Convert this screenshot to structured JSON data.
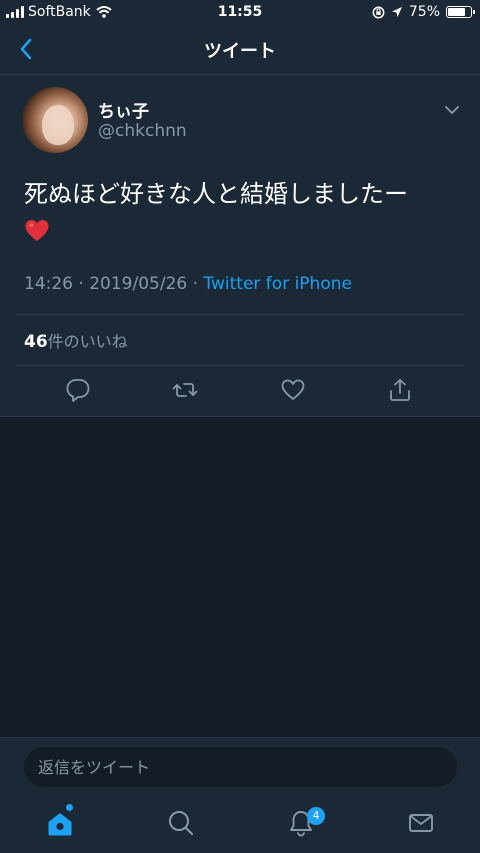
{
  "status_bar": {
    "carrier": "SoftBank",
    "time": "11:55",
    "battery_text": "75%",
    "battery_level": 0.75
  },
  "nav": {
    "title": "ツイート"
  },
  "tweet": {
    "display_name": "ちぃ子",
    "handle": "@chkchnn",
    "text": "死ぬほど好きな人と結婚しましたー",
    "emoji": "heart-emoji",
    "time": "14:26",
    "date": "2019/05/26",
    "separator": "·",
    "source": "Twitter for iPhone",
    "likes_count": "46",
    "likes_label": "件のいいね"
  },
  "reply": {
    "placeholder": "返信をツイート"
  },
  "tabs": {
    "notifications_badge": "4"
  },
  "colors": {
    "background": "#141d26",
    "surface": "#1b2836",
    "accent": "#1da1f2",
    "secondary_text": "#8899a6"
  }
}
